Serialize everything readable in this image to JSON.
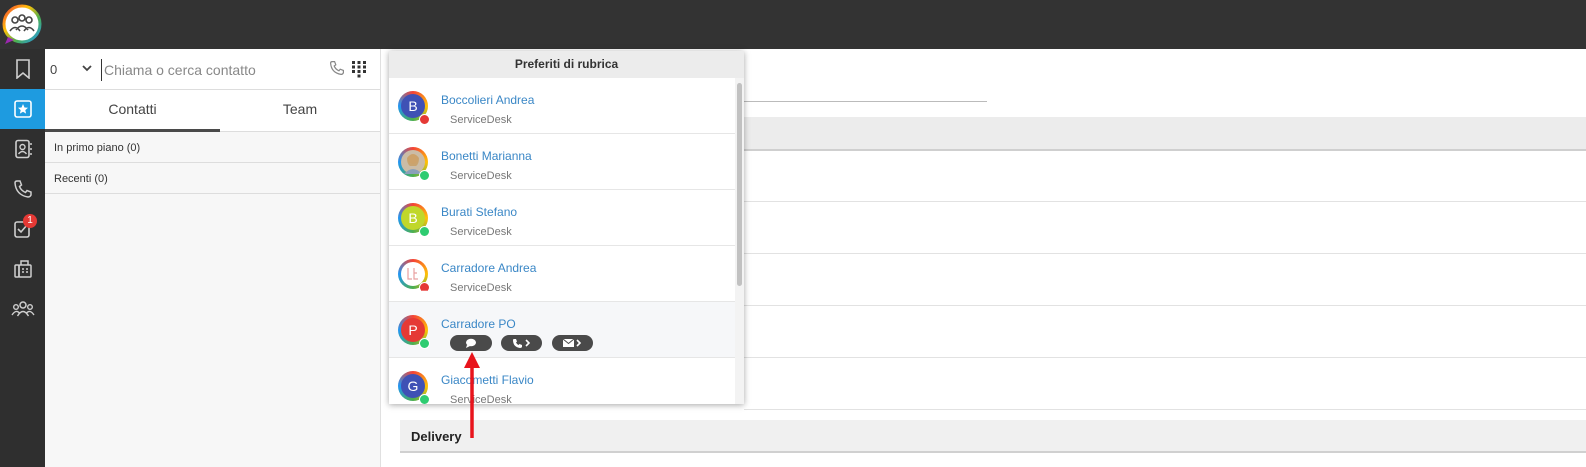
{
  "app": {
    "logo_icon": "team-chat-logo-icon"
  },
  "rail": {
    "items": [
      {
        "icon": "bookmark-icon"
      },
      {
        "icon": "star-favorites-icon",
        "active": true
      },
      {
        "icon": "address-book-icon"
      },
      {
        "icon": "phone-icon"
      },
      {
        "icon": "tasks-icon",
        "badge": "1"
      },
      {
        "icon": "fax-icon"
      },
      {
        "icon": "group-icon"
      }
    ]
  },
  "dialer": {
    "line_value": "0",
    "search_placeholder": "Chiama o cerca contatto"
  },
  "tabs": [
    {
      "label": "Contatti",
      "active": true
    },
    {
      "label": "Team",
      "active": false
    }
  ],
  "sections": [
    {
      "label": "In primo piano (0)"
    },
    {
      "label": "Recenti (0)"
    }
  ],
  "popup": {
    "title": "Preferiti di rubrica",
    "contacts": [
      {
        "name": "Boccolieri Andrea",
        "dept": "ServiceDesk",
        "initial": "B",
        "avatar_color": "#3f51b5",
        "status": "busy",
        "status_color": "#e53935"
      },
      {
        "name": "Bonetti Marianna",
        "dept": "ServiceDesk",
        "initial": "",
        "avatar_color": "#b0a089",
        "status": "online",
        "status_color": "#2ecc71"
      },
      {
        "name": "Burati Stefano",
        "dept": "ServiceDesk",
        "initial": "B",
        "avatar_color": "#c0d72a",
        "status": "online",
        "status_color": "#2ecc71"
      },
      {
        "name": "Carradore Andrea",
        "dept": "ServiceDesk",
        "initial": "",
        "avatar_color": "#ffffff",
        "status": "dnd",
        "status_color": "#e53935"
      },
      {
        "name": "Carradore PO",
        "dept": "",
        "initial": "P",
        "avatar_color": "#e53935",
        "status": "online",
        "status_color": "#2ecc71"
      },
      {
        "name": "Giacometti Flavio",
        "dept": "ServiceDesk",
        "initial": "G",
        "avatar_color": "#3f51b5",
        "status": "online",
        "status_color": "#2ecc71"
      }
    ],
    "actions": [
      {
        "icon": "chat-icon"
      },
      {
        "icon": "phone-call-icon"
      },
      {
        "icon": "email-icon"
      }
    ]
  },
  "main": {
    "delivery_label": "Delivery"
  },
  "annotation": {
    "icon": "red-arrow-icon",
    "color": "#e8141c"
  }
}
